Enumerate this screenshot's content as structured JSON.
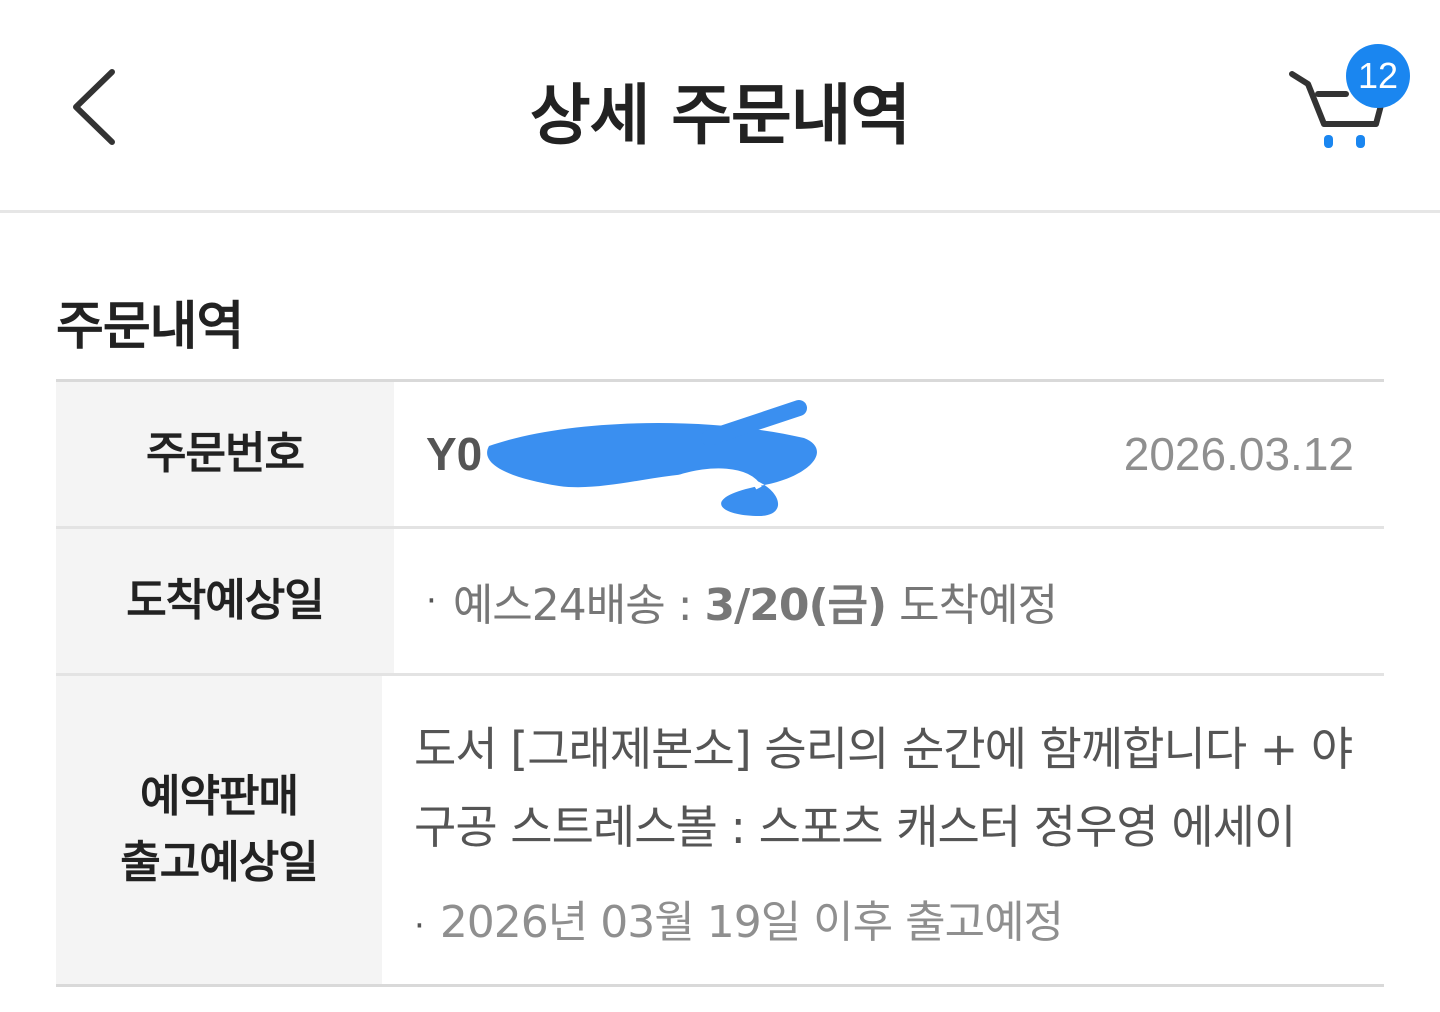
{
  "header": {
    "back_icon": "chevron-left-icon",
    "title": "상세 주문내역",
    "cart_icon": "cart-icon",
    "cart_count": "12",
    "accent_color": "#1a86f0"
  },
  "section": {
    "title": "주문내역"
  },
  "rows": {
    "order_number": {
      "label": "주문번호",
      "value": "Y0",
      "date": "2026.03.12"
    },
    "arrival": {
      "label": "도착예상일",
      "bullet": "·",
      "prefix": "예스24배송 : ",
      "date": "3/20(금)",
      "suffix": " 도착예정"
    },
    "preorder": {
      "label_line1": "예약판매",
      "label_line2": "출고예상일",
      "product_name": "도서 [그래제본소] 승리의 순간에 함께합니다 + 야구공 스트레스볼 : 스포츠 캐스터 정우영 에세이",
      "bullet": "·",
      "ship_note": "2026년 03월 19일 이후 출고예정"
    }
  }
}
